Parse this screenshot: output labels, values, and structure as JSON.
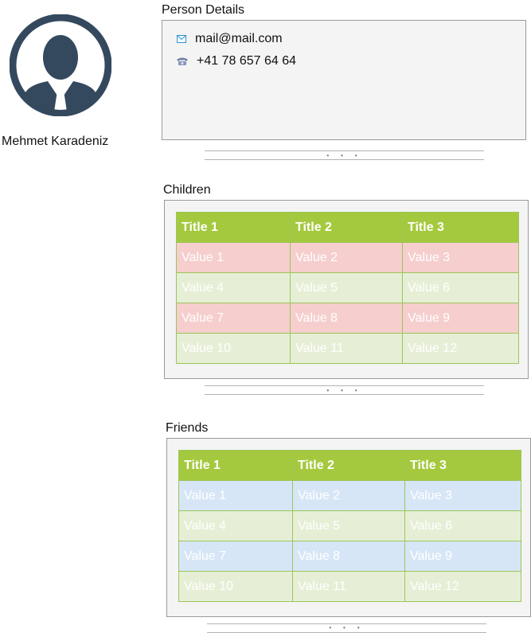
{
  "person": {
    "name": "Mehmet Karadeniz"
  },
  "details": {
    "title": "Person Details",
    "email": "mail@mail.com",
    "phone": "+41 78 657 64 64",
    "email_icon": "envelope-icon",
    "phone_icon": "telephone-icon"
  },
  "separator": {
    "dots": "• • •"
  },
  "children": {
    "title": "Children",
    "headers": [
      "Title 1",
      "Title 2",
      "Title 3"
    ],
    "rows": [
      [
        "Value 1",
        "Value 2",
        "Value 3"
      ],
      [
        "Value 4",
        "Value 5",
        "Value 6"
      ],
      [
        "Value 7",
        "Value 8",
        "Value 9"
      ],
      [
        "Value 10",
        "Value 11",
        "Value 12"
      ]
    ]
  },
  "friends": {
    "title": "Friends",
    "headers": [
      "Title 1",
      "Title 2",
      "Title 3"
    ],
    "rows": [
      [
        "Value 1",
        "Value 2",
        "Value 3"
      ],
      [
        "Value 4",
        "Value 5",
        "Value 6"
      ],
      [
        "Value 7",
        "Value 8",
        "Value 9"
      ],
      [
        "Value 10",
        "Value 11",
        "Value 12"
      ]
    ]
  },
  "colors": {
    "header_green": "#a5c93e",
    "row_pink": "#f6cece",
    "row_blue": "#d7e6f6",
    "row_light_green": "#e6efd6",
    "avatar_dark": "#34495e"
  }
}
